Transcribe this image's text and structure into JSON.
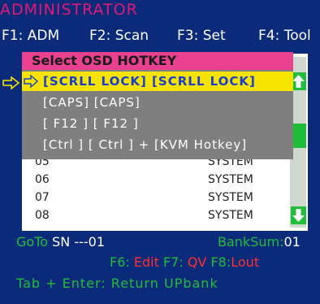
{
  "window_title": "ADMINISTRATOR",
  "menu": [
    {
      "label": "F1: ADM"
    },
    {
      "label": "F2: Scan"
    },
    {
      "label": "F3: Set"
    },
    {
      "label": "F4: Tool"
    }
  ],
  "list": {
    "rows": [
      {
        "num": "05",
        "name": "SYSTEM"
      },
      {
        "num": "06",
        "name": "SYSTEM"
      },
      {
        "num": "07",
        "name": "SYSTEM"
      },
      {
        "num": "08",
        "name": "SYSTEM"
      }
    ]
  },
  "popup": {
    "title": "Select OSD HOTKEY",
    "options": [
      {
        "label": "[SCRLL  LOCK] [SCRLL  LOCK]",
        "selected": true
      },
      {
        "label": "[CAPS] [CAPS]",
        "selected": false
      },
      {
        "label": "[ F12 ] [ F12 ]",
        "selected": false
      },
      {
        "label": "[Ctrl  ] [ Ctrl ] + [KVM Hotkey]",
        "selected": false
      }
    ]
  },
  "footer": {
    "goto_label": "GoTo",
    "sn_text": "SN ---01",
    "banksum_label": "BankSum:",
    "banksum_value": "01",
    "f6_key": "F6:",
    "f6_action": "Edit",
    "f7_key": "F7:",
    "f7_action": "QV",
    "f8_key": "F8:",
    "f8_action": "Lout",
    "tab_hint": "Tab + Enter: Return UPbank"
  },
  "colors": {
    "background": "#0b2a7a",
    "title": "#e01a78",
    "accent_green": "#1fbe3a",
    "selection_yellow": "#f6e400",
    "popup_header": "#e9418f",
    "action_red": "#ff3030"
  },
  "icons": [
    "pointer-arrow-icon",
    "scroll-up-icon",
    "scroll-down-icon"
  ]
}
